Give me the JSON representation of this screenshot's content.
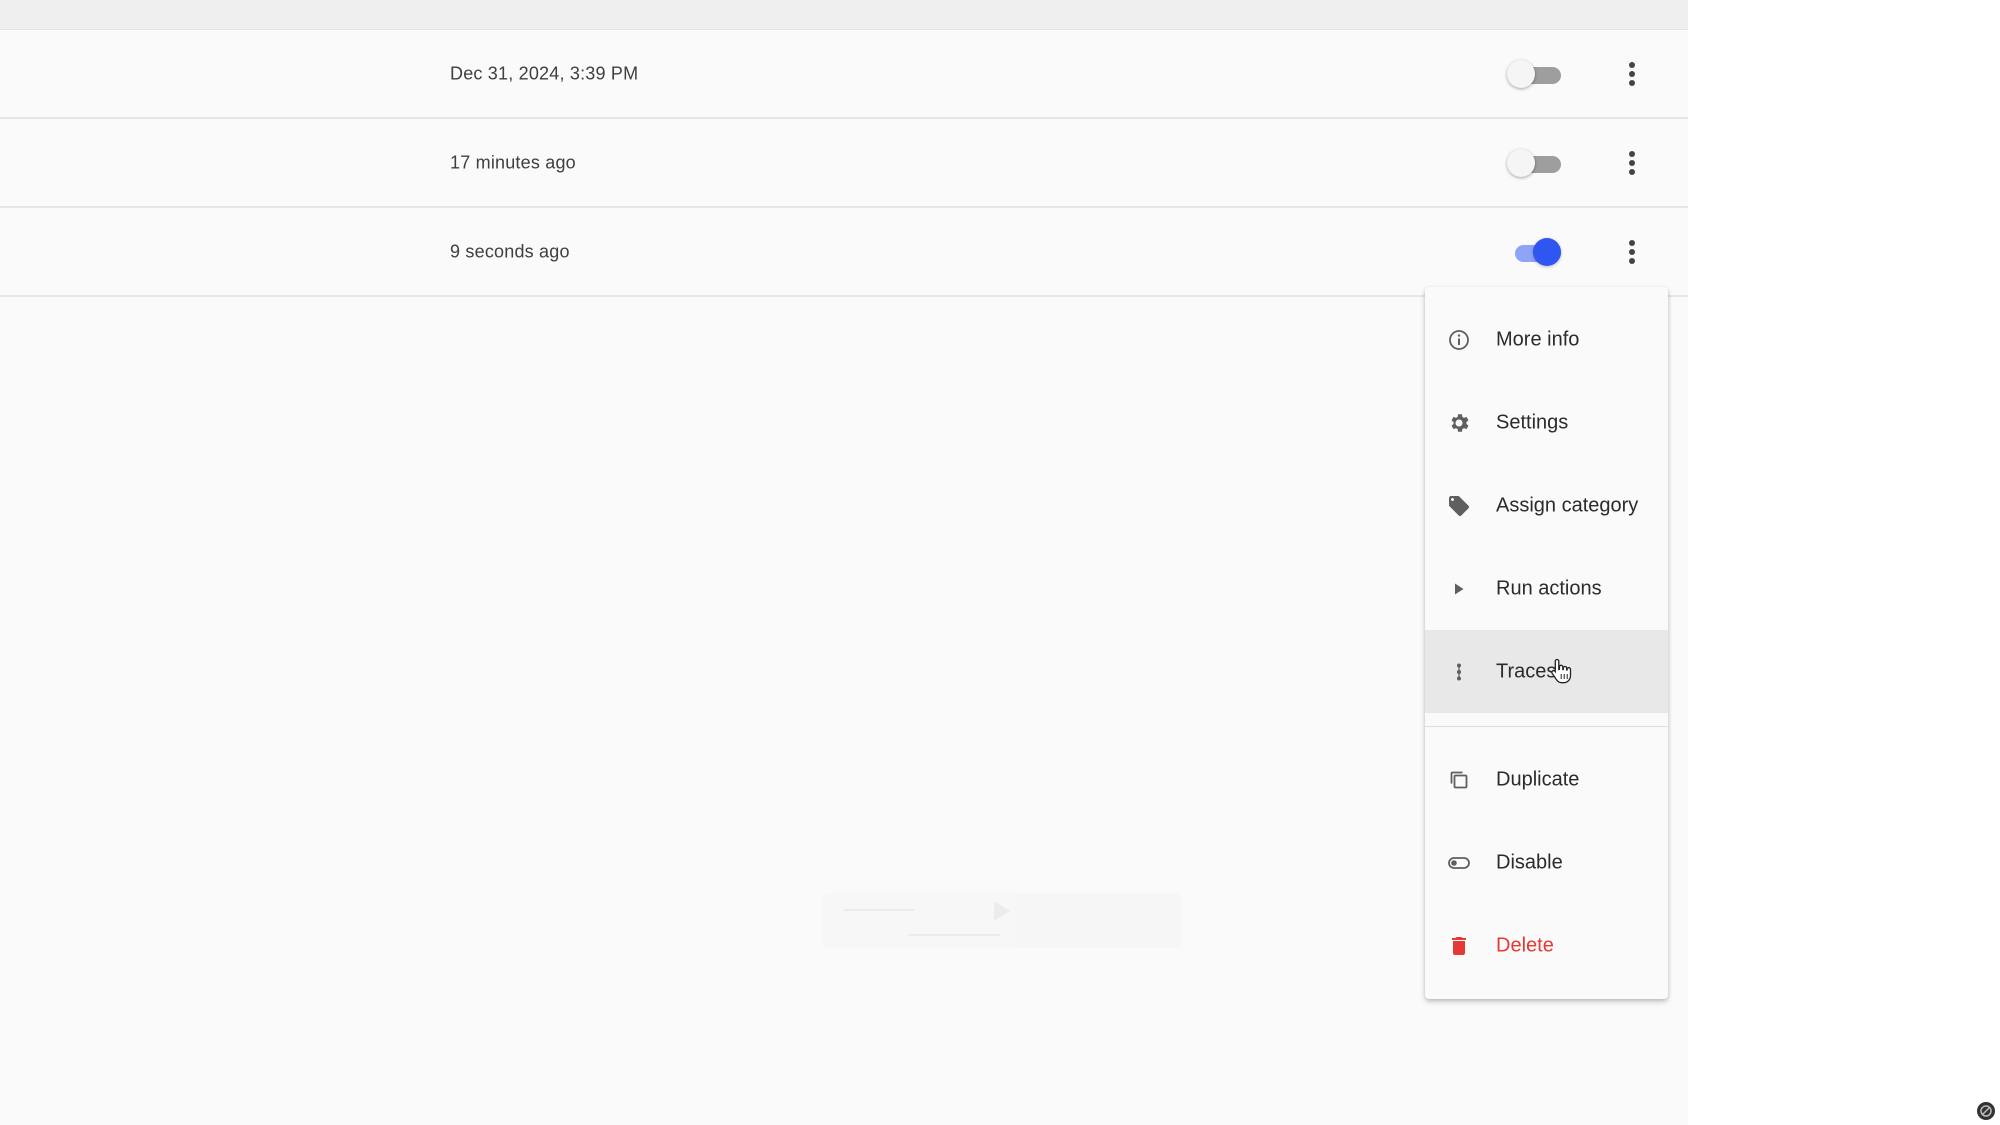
{
  "rows": [
    {
      "time": "Dec 31, 2024, 3:39 PM",
      "enabled": false
    },
    {
      "time": "17 minutes ago",
      "enabled": false
    },
    {
      "time": "9 seconds ago",
      "enabled": true
    }
  ],
  "menu": {
    "items": [
      {
        "label": "More info",
        "icon": "info-icon"
      },
      {
        "label": "Settings",
        "icon": "gear-icon"
      },
      {
        "label": "Assign category",
        "icon": "tag-icon"
      },
      {
        "label": "Run actions",
        "icon": "play-icon"
      },
      {
        "label": "Traces",
        "icon": "traces-icon"
      },
      {
        "label": "Duplicate",
        "icon": "duplicate-icon"
      },
      {
        "label": "Disable",
        "icon": "toggle-off-icon"
      },
      {
        "label": "Delete",
        "icon": "trash-icon"
      }
    ],
    "hovered_item": "Traces"
  },
  "colors": {
    "accent": "#2f56f0",
    "danger": "#e53935",
    "background": "#fafafa"
  }
}
